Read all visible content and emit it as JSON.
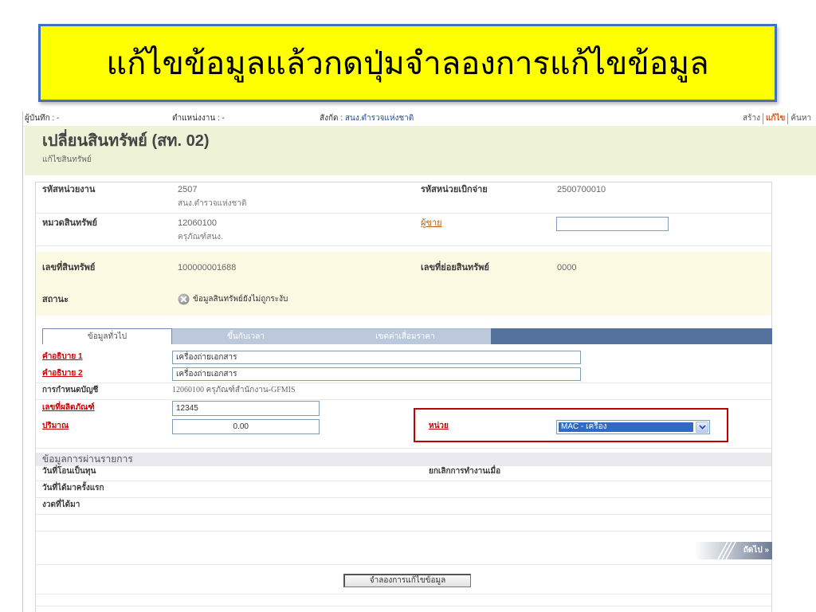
{
  "banner": {
    "text": "แก้ไขข้อมูลแล้วกดปุ่มจำลองการแก้ไขข้อมูล"
  },
  "topbar": {
    "recorder": {
      "label": "ผู้บันทึก :",
      "value": "-"
    },
    "position": {
      "label": "ตำแหน่งงาน :",
      "value": "-"
    },
    "affiliation": {
      "label": "สังกัด :",
      "value": "สนง.ตำรวจแห่งชาติ"
    },
    "actions": [
      {
        "label": "สร้าง",
        "active": false
      },
      {
        "label": "แก้ไข",
        "active": true
      },
      {
        "label": "ค้นหา",
        "active": false
      }
    ]
  },
  "page": {
    "title": "เปลี่ยนสินทรัพย์ (สท. 02)",
    "subtitle": "แก้ไขสินทรัพย์"
  },
  "header_fields": {
    "agency_code": {
      "label": "รหัสหน่วยงาน",
      "value": "2507",
      "description": "สนง.ตำรวจแห่งชาติ"
    },
    "disbursement_unit": {
      "label": "รหัสหน่วยเบิกจ่าย",
      "value": "2500700010"
    },
    "asset_class": {
      "label": "หมวดสินทรัพย์",
      "value": "12060100",
      "description": "ครุภัณฑ์สนง."
    },
    "vendor": {
      "label": "ผู้ขาย",
      "value": ""
    },
    "asset_number": {
      "label": "เลขที่สินทรัพย์",
      "value": "100000001688"
    },
    "asset_subnumber": {
      "label": "เลขที่ย่อยสินทรัพย์",
      "value": "0000"
    },
    "status": {
      "label": "สถานะ",
      "value": "ข้อมูลสินทรัพย์ยังไม่ถูกระงับ",
      "icon": "cancel-circle-icon"
    }
  },
  "tabs": [
    {
      "label": "ข้อมูลทั่วไป",
      "active": true
    },
    {
      "label": "ขึ้นกับเวลา",
      "active": false
    },
    {
      "label": "เขตค่าเสื่อมราคา",
      "active": false
    }
  ],
  "general": {
    "description1": {
      "label": "คำอธิบาย 1",
      "value": "เครื่องถ่ายเอกสาร"
    },
    "description2": {
      "label": "คำอธิบาย 2",
      "value": "เครื่องถ่ายเอกสาร"
    },
    "account_determination": {
      "label": "การกำหนดบัญชี",
      "value": "12060100 ครุภัณฑ์สำนักงาน-GFMIS"
    },
    "serial_number": {
      "label": "เลขที่ผลิตภัณฑ์",
      "value": "12345"
    },
    "quantity": {
      "label": "ปริมาณ",
      "value": "0.00"
    },
    "unit": {
      "label": "หน่วย",
      "value": "MAC - เครื่อง"
    }
  },
  "posting": {
    "header": "ข้อมูลการผ่านรายการ",
    "capitalization_date": {
      "label": "วันที่โอนเป็นทุน"
    },
    "deactivation_date": {
      "label": "ยกเลิกการทำงานเมื่อ"
    },
    "first_acquisition_date": {
      "label": "วันที่ได้มาครั้งแรก"
    },
    "acquisition_period": {
      "label": "งวดที่ได้มา"
    }
  },
  "next": {
    "label": "ถัดไป »"
  },
  "simulate_button": {
    "label": "จำลองการแก้ไขข้อมูล"
  },
  "colors": {
    "banner_background": "#FFFF00",
    "banner_border": "#3F72B7",
    "title_band": "#EEF3D7",
    "status_band": "#FCFAE3",
    "link_red": "#CC0000",
    "active_action": "#E0561A",
    "highlight_border": "#C00000",
    "selection_blue": "#316AC5",
    "tab_bar": "#55729F"
  }
}
